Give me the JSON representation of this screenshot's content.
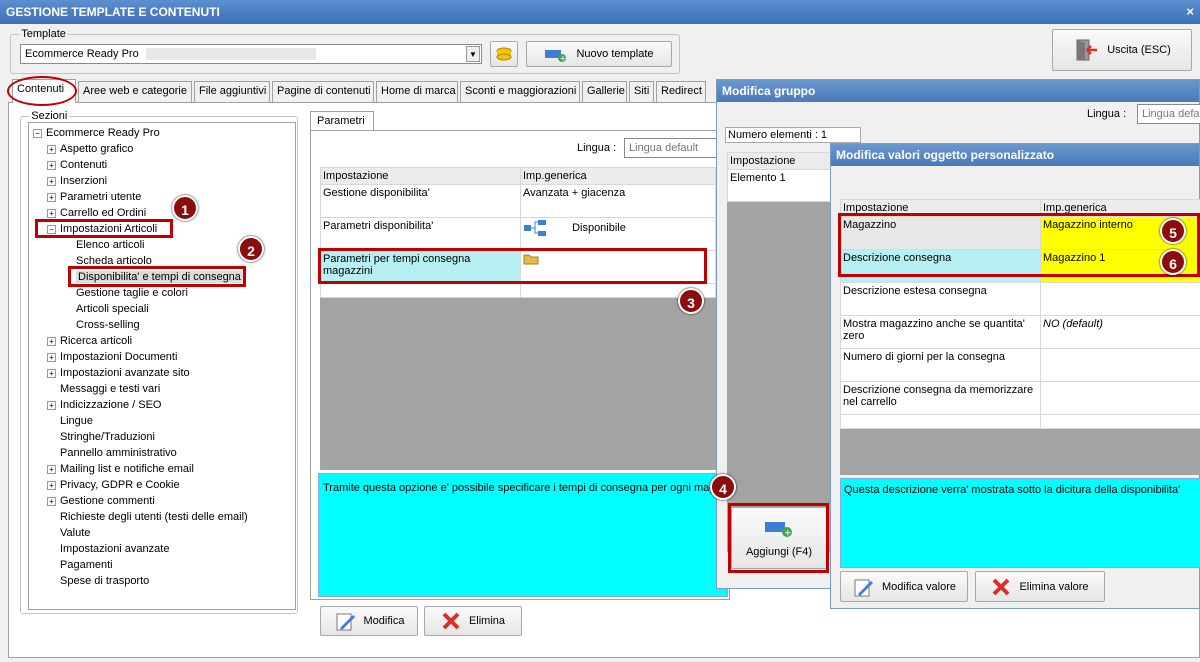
{
  "window": {
    "title": "GESTIONE TEMPLATE E CONTENUTI",
    "close_label": "×"
  },
  "template": {
    "group_label": "Template",
    "selected": "Ecommerce Ready Pro",
    "new_button": "Nuovo template",
    "exit_button": "Uscita (ESC)"
  },
  "tabs": [
    "Contenuti",
    "Aree web e categorie",
    "File aggiuntivi",
    "Pagine di contenuti",
    "Home di marca",
    "Sconti e maggiorazioni",
    "Gallerie",
    "Siti",
    "Redirect"
  ],
  "sections": {
    "label": "Sezioni",
    "root": "Ecommerce Ready Pro",
    "items": [
      {
        "label": "Aspetto grafico",
        "exp": "+"
      },
      {
        "label": "Contenuti",
        "exp": "+"
      },
      {
        "label": "Inserzioni",
        "exp": "+"
      },
      {
        "label": "Parametri utente",
        "exp": "+"
      },
      {
        "label": "Carrello ed Ordini",
        "exp": "+"
      },
      {
        "label": "Impostazioni Articoli",
        "exp": "−"
      },
      {
        "label": "Elenco articoli",
        "exp": "",
        "child": true
      },
      {
        "label": "Scheda articolo",
        "exp": "",
        "child": true
      },
      {
        "label": "Disponibilita' e tempi di consegna",
        "exp": "",
        "child": true,
        "selected": true
      },
      {
        "label": "Gestione taglie e colori",
        "exp": "",
        "child": true
      },
      {
        "label": "Articoli speciali",
        "exp": "",
        "child": true
      },
      {
        "label": "Cross-selling",
        "exp": "",
        "child": true
      },
      {
        "label": "Ricerca articoli",
        "exp": "+"
      },
      {
        "label": "Impostazioni Documenti",
        "exp": "+"
      },
      {
        "label": "Impostazioni avanzate sito",
        "exp": "+"
      },
      {
        "label": "Messaggi e testi vari",
        "exp": ""
      },
      {
        "label": "Indicizzazione / SEO",
        "exp": "+"
      },
      {
        "label": "Lingue",
        "exp": ""
      },
      {
        "label": "Stringhe/Traduzioni",
        "exp": ""
      },
      {
        "label": "Pannello amministrativo",
        "exp": ""
      },
      {
        "label": "Mailing list e notifiche email",
        "exp": "+"
      },
      {
        "label": "Privacy, GDPR e Cookie",
        "exp": "+"
      },
      {
        "label": "Gestione commenti",
        "exp": "+"
      },
      {
        "label": "Richieste degli utenti (testi delle email)",
        "exp": ""
      },
      {
        "label": "Valute",
        "exp": ""
      },
      {
        "label": "Impostazioni avanzate",
        "exp": ""
      },
      {
        "label": "Pagamenti",
        "exp": ""
      },
      {
        "label": "Spese di trasporto",
        "exp": ""
      }
    ]
  },
  "params": {
    "tab": "Parametri",
    "lingua_label": "Lingua :",
    "lingua_value": "Lingua default",
    "col1": "Impostazione",
    "col2": "Imp.generica",
    "rows": [
      {
        "name": "Gestione disponibilita'",
        "value": "Avanzata + giacenza"
      },
      {
        "name": "Parametri disponibilita'",
        "value": "Disponibile"
      },
      {
        "name": "Parametri per tempi consegna magazzini",
        "value": ""
      }
    ],
    "description": "Tramite questa opzione e' possibile specificare i tempi di consegna per ogni magazz",
    "modify_button": "Modifica",
    "delete_button": "Elimina"
  },
  "group_dialog": {
    "title": "Modifica gruppo",
    "lingua_label": "Lingua :",
    "lingua_value": "Lingua default",
    "count": "Numero elementi : 1",
    "col1": "Impostazione",
    "row1": "Elemento 1",
    "add_button": "Aggiungi (F4)"
  },
  "obj_dialog": {
    "title": "Modifica valori oggetto personalizzato",
    "col1": "Impostazione",
    "col2": "Imp.generica",
    "rows": [
      {
        "name": "Magazzino",
        "value": "Magazzino interno"
      },
      {
        "name": "Descrizione consegna",
        "value": "Magazzino 1"
      },
      {
        "name": "Descrizione estesa consegna",
        "value": ""
      },
      {
        "name": "Mostra magazzino anche se quantita' zero",
        "value": "NO (default)"
      },
      {
        "name": "Numero di giorni per la consegna",
        "value": ""
      },
      {
        "name": "Descrizione consegna da memorizzare nel carrello",
        "value": ""
      }
    ],
    "description": "Questa descrizione verra' mostrata sotto la dicitura della disponibilita'",
    "modify_button": "Modifica valore",
    "delete_button": "Elimina valore"
  },
  "badges": [
    "1",
    "2",
    "3",
    "4",
    "5",
    "6"
  ],
  "colors": {
    "accent": "#3c6fb4",
    "highlight_cyan": "#00ffff",
    "highlight_yellow": "#ffff00",
    "annotation_red": "#c00000"
  }
}
